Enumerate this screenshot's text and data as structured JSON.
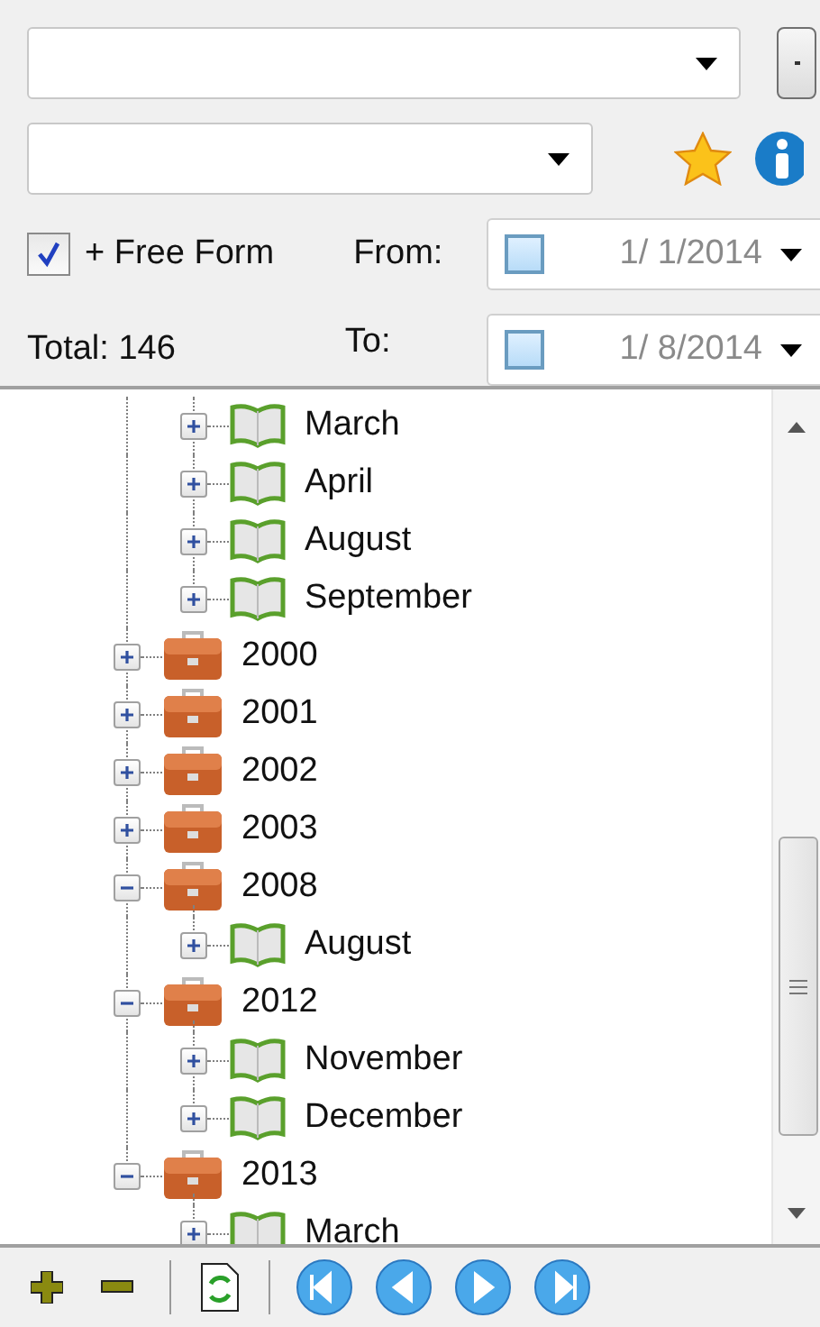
{
  "filter": {
    "free_form": {
      "label": "+ Free Form",
      "checked": true
    },
    "from": {
      "label": "From:",
      "value": "1/ 1/2014",
      "checked": false
    },
    "to": {
      "label": "To:",
      "value": "1/ 8/2014",
      "checked": false
    },
    "total": "Total: 146"
  },
  "tree": {
    "nodes": [
      {
        "children": [
          {
            "kind": "month",
            "label": "March",
            "expanded": false
          },
          {
            "kind": "month",
            "label": "April",
            "expanded": false
          },
          {
            "kind": "month",
            "label": "August",
            "expanded": false
          },
          {
            "kind": "month",
            "label": "September",
            "expanded": false
          }
        ]
      },
      {
        "kind": "year",
        "label": "2000",
        "expanded": false
      },
      {
        "kind": "year",
        "label": "2001",
        "expanded": false
      },
      {
        "kind": "year",
        "label": "2002",
        "expanded": false
      },
      {
        "kind": "year",
        "label": "2003",
        "expanded": false
      },
      {
        "kind": "year",
        "label": "2008",
        "expanded": true,
        "children": [
          {
            "kind": "month",
            "label": "August",
            "expanded": false
          }
        ]
      },
      {
        "kind": "year",
        "label": "2012",
        "expanded": true,
        "children": [
          {
            "kind": "month",
            "label": "November",
            "expanded": false
          },
          {
            "kind": "month",
            "label": "December",
            "expanded": false
          }
        ]
      },
      {
        "kind": "year",
        "label": "2013",
        "expanded": true,
        "children": [
          {
            "kind": "month",
            "label": "March",
            "expanded": false
          }
        ]
      }
    ]
  }
}
